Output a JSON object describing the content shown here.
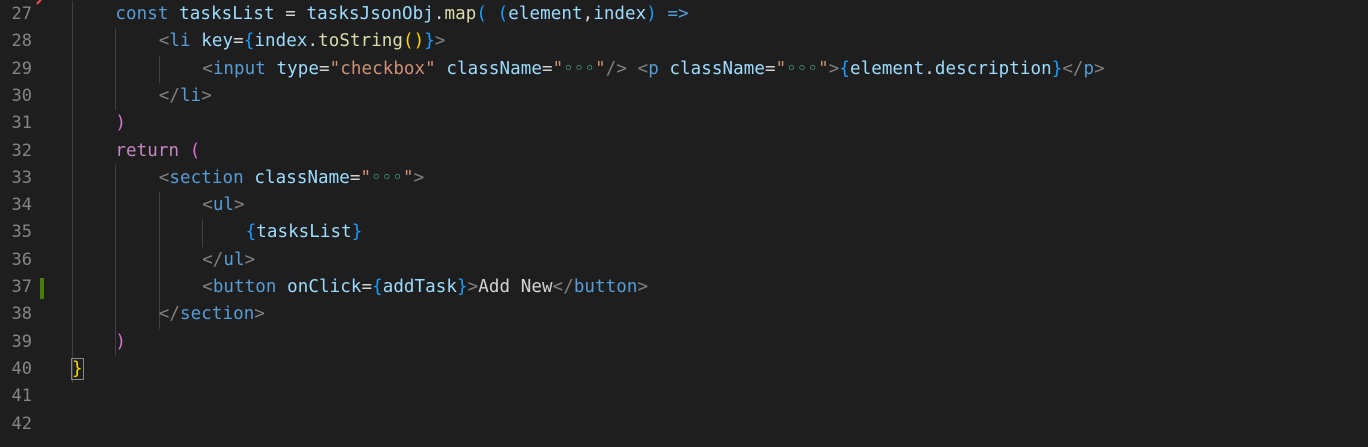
{
  "editor": {
    "line_numbers": [
      "27",
      "28",
      "29",
      "30",
      "31",
      "32",
      "33",
      "34",
      "35",
      "36",
      "37",
      "38",
      "39",
      "40",
      "41",
      "42"
    ],
    "modified_line": "37",
    "lines": [
      [
        {
          "t": "const",
          "c": "kw"
        },
        {
          "t": " ",
          "c": "op"
        },
        {
          "t": "tasksList",
          "c": "var"
        },
        {
          "t": " = ",
          "c": "op"
        },
        {
          "t": "tasksJsonObj",
          "c": "var"
        },
        {
          "t": ".",
          "c": "op"
        },
        {
          "t": "map",
          "c": "fn"
        },
        {
          "t": "(",
          "c": "paren2"
        },
        {
          "t": " ",
          "c": "op"
        },
        {
          "t": "(",
          "c": "paren2"
        },
        {
          "t": "element",
          "c": "var"
        },
        {
          "t": ",",
          "c": "op"
        },
        {
          "t": "index",
          "c": "var"
        },
        {
          "t": ")",
          "c": "paren2"
        },
        {
          "t": " ",
          "c": "op"
        },
        {
          "t": "=>",
          "c": "kw"
        }
      ],
      [
        {
          "t": "<",
          "c": "angle"
        },
        {
          "t": "li",
          "c": "tag"
        },
        {
          "t": " ",
          "c": "op"
        },
        {
          "t": "key",
          "c": "attr"
        },
        {
          "t": "=",
          "c": "op"
        },
        {
          "t": "{",
          "c": "paren2"
        },
        {
          "t": "index",
          "c": "var"
        },
        {
          "t": ".",
          "c": "op"
        },
        {
          "t": "toString",
          "c": "fn"
        },
        {
          "t": "()",
          "c": "brace"
        },
        {
          "t": "}",
          "c": "paren2"
        },
        {
          "t": ">",
          "c": "angle"
        }
      ],
      [
        {
          "t": "<",
          "c": "angle"
        },
        {
          "t": "input",
          "c": "tag"
        },
        {
          "t": " ",
          "c": "op"
        },
        {
          "t": "type",
          "c": "attr"
        },
        {
          "t": "=",
          "c": "op"
        },
        {
          "t": "\"checkbox\"",
          "c": "str"
        },
        {
          "t": " ",
          "c": "op"
        },
        {
          "t": "className",
          "c": "attr"
        },
        {
          "t": "=",
          "c": "op"
        },
        {
          "t": "\"",
          "c": "str"
        },
        {
          "t": "◦◦◦",
          "c": "ellipsis"
        },
        {
          "t": "\"",
          "c": "str"
        },
        {
          "t": "/>",
          "c": "angle"
        },
        {
          "t": " ",
          "c": "op"
        },
        {
          "t": "<",
          "c": "angle"
        },
        {
          "t": "p",
          "c": "tag"
        },
        {
          "t": " ",
          "c": "op"
        },
        {
          "t": "className",
          "c": "attr"
        },
        {
          "t": "=",
          "c": "op"
        },
        {
          "t": "\"",
          "c": "str"
        },
        {
          "t": "◦◦◦",
          "c": "ellipsis"
        },
        {
          "t": "\"",
          "c": "str"
        },
        {
          "t": ">",
          "c": "angle"
        },
        {
          "t": "{",
          "c": "paren2"
        },
        {
          "t": "element",
          "c": "var"
        },
        {
          "t": ".",
          "c": "op"
        },
        {
          "t": "description",
          "c": "var"
        },
        {
          "t": "}",
          "c": "paren2"
        },
        {
          "t": "</",
          "c": "angle"
        },
        {
          "t": "p",
          "c": "tag"
        },
        {
          "t": ">",
          "c": "angle"
        }
      ],
      [
        {
          "t": "</",
          "c": "angle"
        },
        {
          "t": "li",
          "c": "tag"
        },
        {
          "t": ">",
          "c": "angle"
        }
      ],
      [
        {
          "t": ")",
          "c": "paren1"
        }
      ],
      [
        {
          "t": "return",
          "c": "ctrl"
        },
        {
          "t": " ",
          "c": "op"
        },
        {
          "t": "(",
          "c": "paren1"
        }
      ],
      [
        {
          "t": "<",
          "c": "angle"
        },
        {
          "t": "section",
          "c": "tag"
        },
        {
          "t": " ",
          "c": "op"
        },
        {
          "t": "className",
          "c": "attr"
        },
        {
          "t": "=",
          "c": "op"
        },
        {
          "t": "\"",
          "c": "str"
        },
        {
          "t": "◦◦◦",
          "c": "ellipsis"
        },
        {
          "t": "\"",
          "c": "str"
        },
        {
          "t": ">",
          "c": "angle"
        }
      ],
      [
        {
          "t": "<",
          "c": "angle"
        },
        {
          "t": "ul",
          "c": "tag"
        },
        {
          "t": ">",
          "c": "angle"
        }
      ],
      [
        {
          "t": "{",
          "c": "paren2"
        },
        {
          "t": "tasksList",
          "c": "var"
        },
        {
          "t": "}",
          "c": "paren2"
        }
      ],
      [
        {
          "t": "</",
          "c": "angle"
        },
        {
          "t": "ul",
          "c": "tag"
        },
        {
          "t": ">",
          "c": "angle"
        }
      ],
      [
        {
          "t": "<",
          "c": "angle"
        },
        {
          "t": "button",
          "c": "tag"
        },
        {
          "t": " ",
          "c": "op"
        },
        {
          "t": "onClick",
          "c": "attr"
        },
        {
          "t": "=",
          "c": "op"
        },
        {
          "t": "{",
          "c": "paren2"
        },
        {
          "t": "addTask",
          "c": "var"
        },
        {
          "t": "}",
          "c": "paren2"
        },
        {
          "t": ">",
          "c": "angle"
        },
        {
          "t": "Add New",
          "c": "text"
        },
        {
          "t": "</",
          "c": "angle"
        },
        {
          "t": "button",
          "c": "tag"
        },
        {
          "t": ">",
          "c": "angle"
        }
      ],
      [
        {
          "t": "</",
          "c": "angle"
        },
        {
          "t": "section",
          "c": "tag"
        },
        {
          "t": ">",
          "c": "angle"
        }
      ],
      [
        {
          "t": ")",
          "c": "paren1"
        }
      ],
      [
        {
          "t": "}",
          "c": "brace"
        }
      ],
      [],
      []
    ]
  }
}
